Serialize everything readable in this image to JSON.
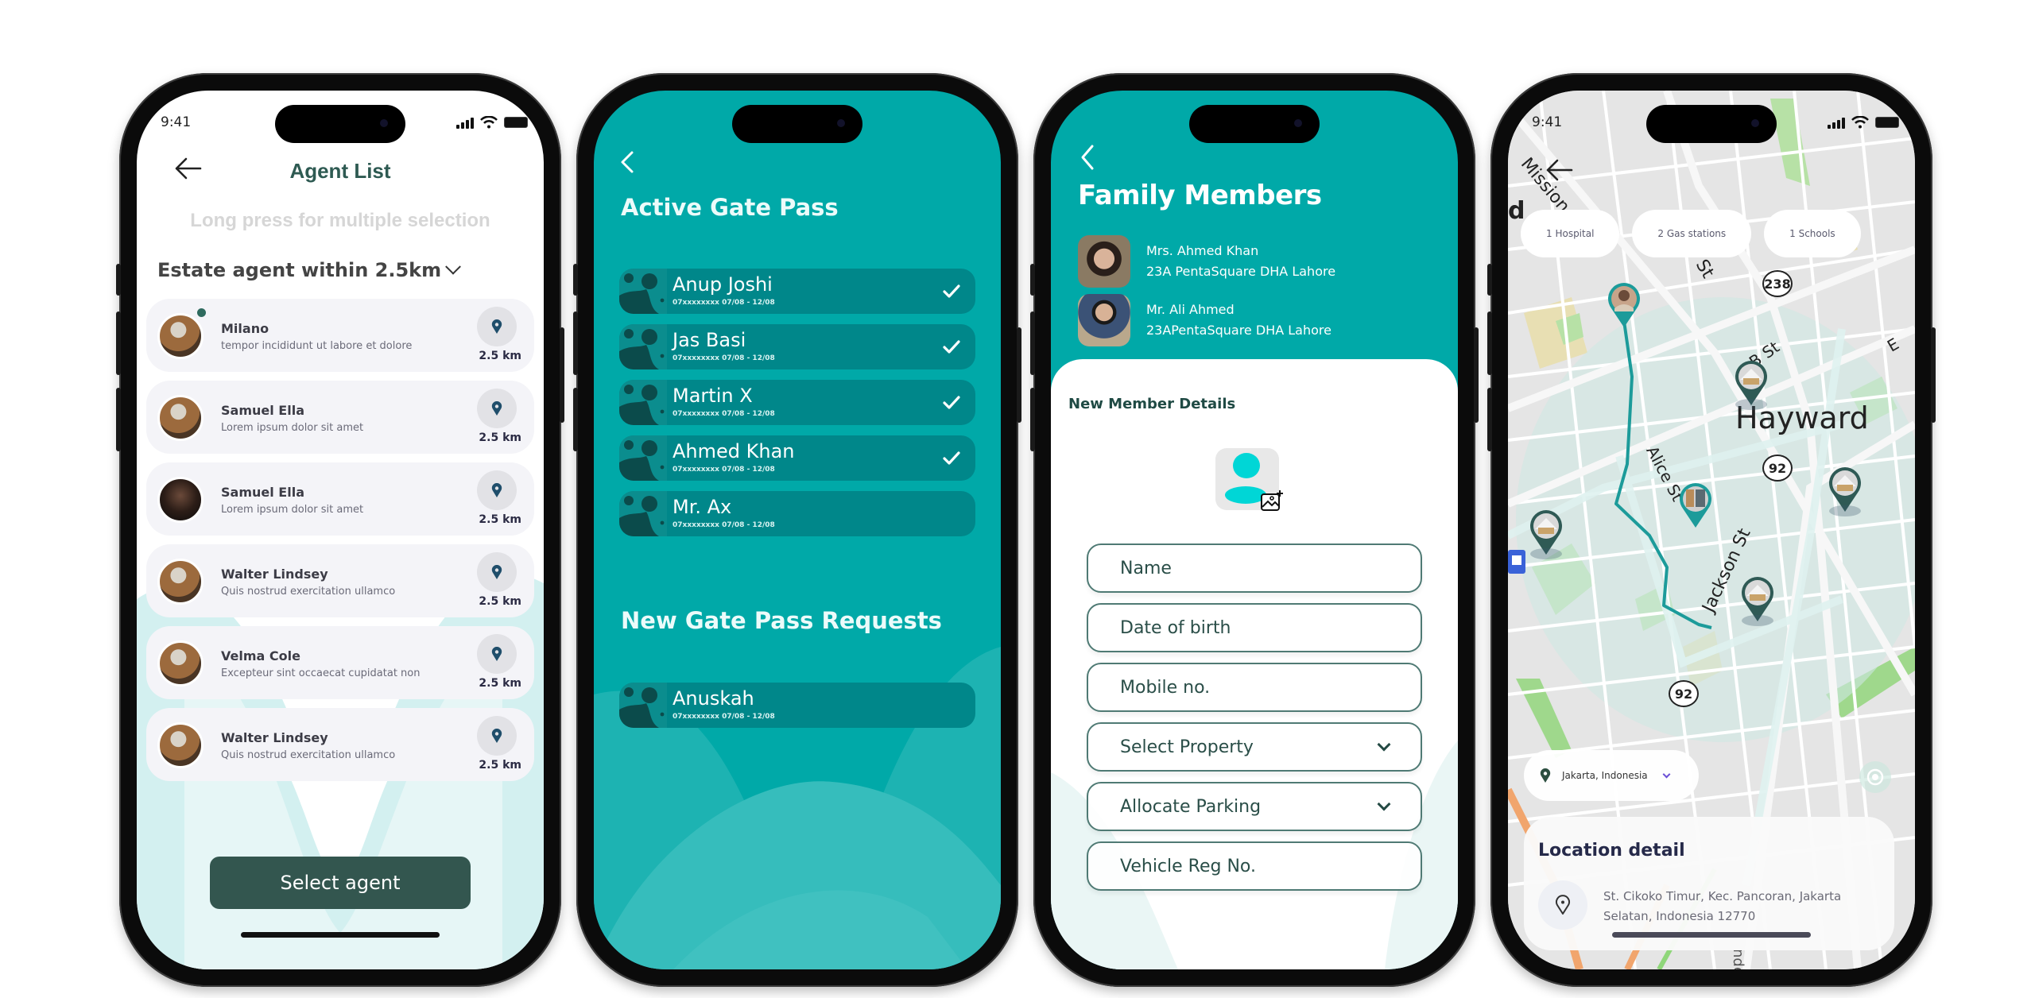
{
  "status_bar": {
    "time": "9:41"
  },
  "agent_list_screen": {
    "title": "Agent List",
    "hint": "Long press for multiple selection",
    "filter_label": "Estate agent within 2.5km",
    "agents": [
      {
        "name": "Milano",
        "description": "tempor incididunt ut labore et dolore",
        "distance": "2.5 km",
        "online": true,
        "avatar": "warm"
      },
      {
        "name": "Samuel Ella",
        "description": "Lorem ipsum dolor sit amet",
        "distance": "2.5 km",
        "online": false,
        "avatar": "warm"
      },
      {
        "name": "Samuel Ella",
        "description": "Lorem ipsum dolor sit amet",
        "distance": "2.5 km",
        "online": false,
        "avatar": "dark"
      },
      {
        "name": "Walter Lindsey",
        "description": "Quis nostrud exercitation ullamco",
        "distance": "2.5 km",
        "online": false,
        "avatar": "warm"
      },
      {
        "name": "Velma Cole",
        "description": "Excepteur sint occaecat cupidatat non",
        "distance": "2.5 km",
        "online": false,
        "avatar": "warm"
      },
      {
        "name": "Walter Lindsey",
        "description": "Quis nostrud exercitation ullamco",
        "distance": "2.5 km",
        "online": false,
        "avatar": "warm"
      }
    ],
    "select_button": "Select  agent"
  },
  "gate_pass_screen": {
    "active_title": "Active Gate Pass",
    "active_passes": [
      {
        "name": "Anup Joshi",
        "meta": "07xxxxxxxx 07/08 - 12/08",
        "approved": true
      },
      {
        "name": "Jas Basi",
        "meta": "07xxxxxxxx 07/08 - 12/08",
        "approved": true
      },
      {
        "name": "Martin X",
        "meta": "07xxxxxxxx 07/08 - 12/08",
        "approved": true
      },
      {
        "name": "Ahmed Khan",
        "meta": "07xxxxxxxx 07/08 - 12/08",
        "approved": true
      },
      {
        "name": "Mr. Ax",
        "meta": "07xxxxxxxx 07/08 - 12/08",
        "approved": false
      }
    ],
    "requests_title": "New Gate Pass Requests",
    "requests": [
      {
        "name": "Anuskah",
        "meta": "07xxxxxxxx 07/08 - 12/08",
        "approved": false
      }
    ]
  },
  "family_screen": {
    "title": "Family Members",
    "members": [
      {
        "name": "Mrs. Ahmed Khan",
        "address": "23A PentaSquare DHA Lahore"
      },
      {
        "name": "Mr. Ali Ahmed",
        "address": "23APentaSquare DHA Lahore"
      }
    ],
    "form_title": "New Member Details",
    "fields": [
      {
        "placeholder": "Name",
        "type": "text"
      },
      {
        "placeholder": "Date of birth",
        "type": "text"
      },
      {
        "placeholder": "Mobile no.",
        "type": "text"
      },
      {
        "placeholder": "Select Property",
        "type": "select"
      },
      {
        "placeholder": "Allocate Parking",
        "type": "select"
      },
      {
        "placeholder": "Vehicle Reg No.",
        "type": "text"
      }
    ]
  },
  "map_screen": {
    "chips": [
      "1 Hospital",
      "2 Gas stations",
      "1 Schools"
    ],
    "labels": {
      "city": "Hayward",
      "mission": "Mission Blvd",
      "alice": "Alice St",
      "jackson": "Jackson St",
      "b_st": "B St",
      "st": "St",
      "e": "E",
      "d": "d",
      "nderwo": "nderwo"
    },
    "highways": [
      "238",
      "92",
      "92"
    ],
    "location_selector": "Jakarta, Indonesia",
    "detail_title": "Location detail",
    "detail_address": "St. Cikoko Timur, Kec. Pancoran, Jakarta Selatan, Indonesia 12770"
  },
  "colors": {
    "teal": "#00a9a8",
    "teal_dark": "#00878a",
    "agent_green": "#33564f",
    "pin_blue": "#1f4e6b"
  }
}
